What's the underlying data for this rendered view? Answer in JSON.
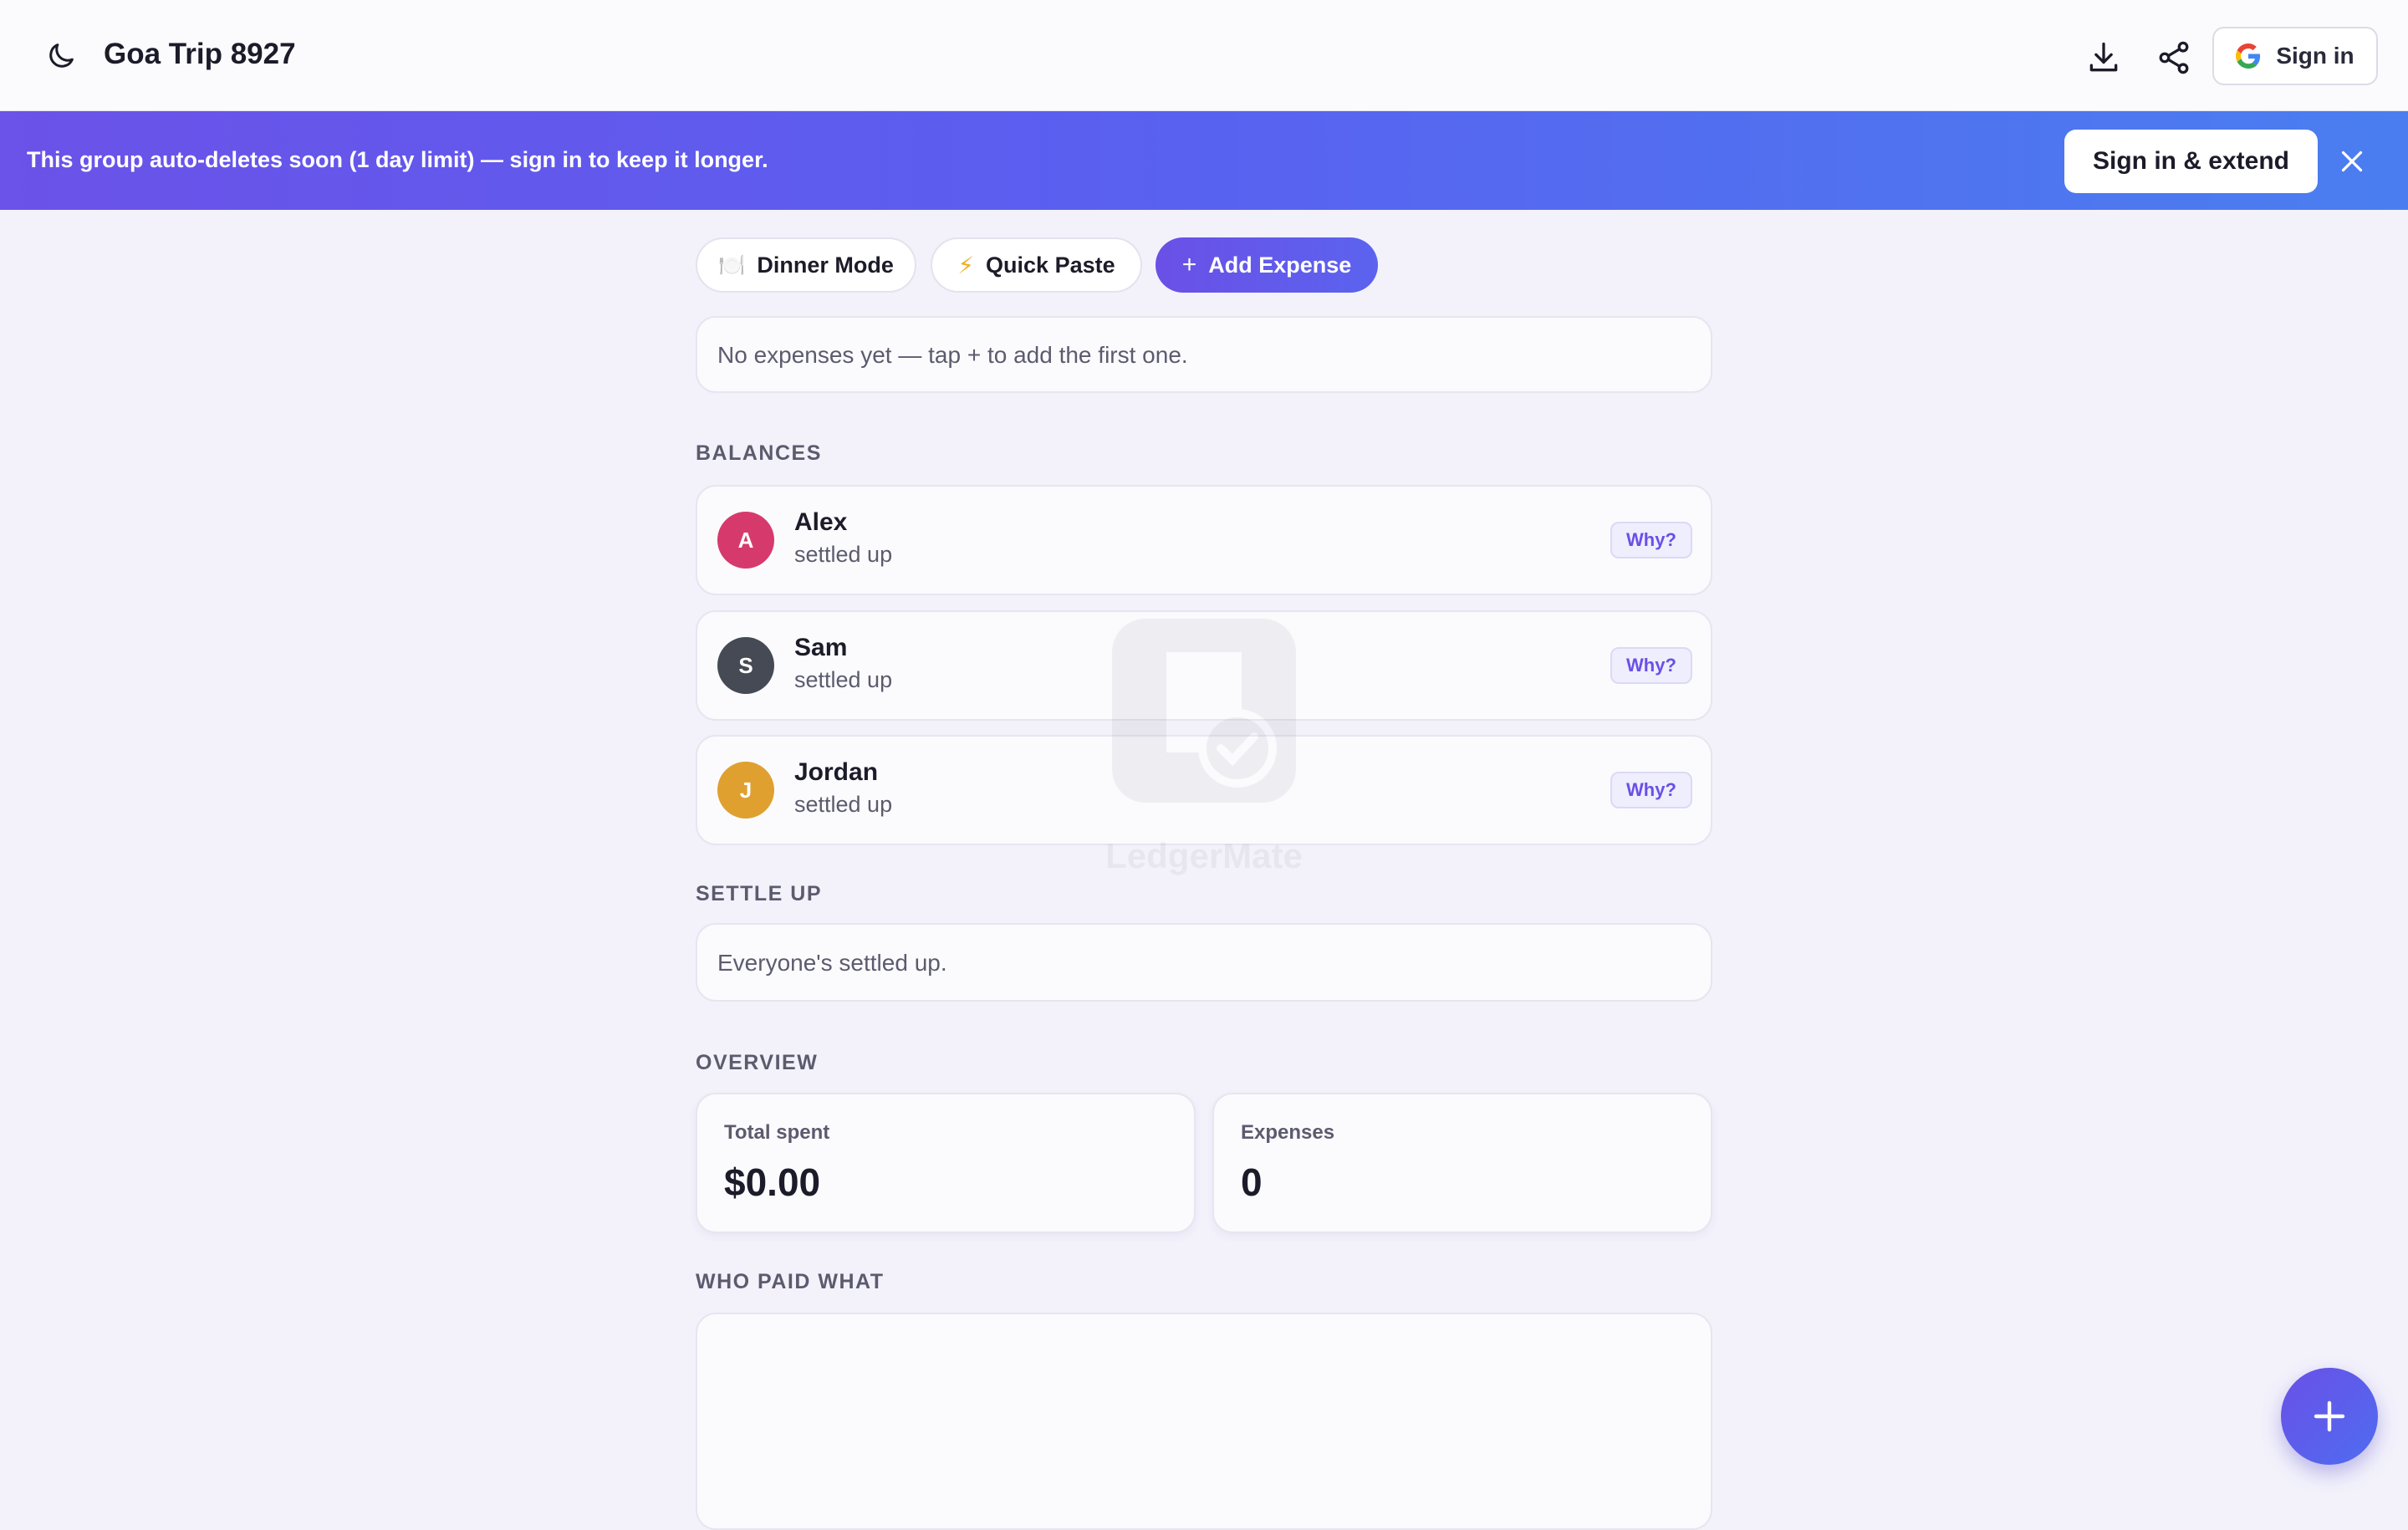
{
  "header": {
    "title": "Goa Trip 8927",
    "sign_in_label": "Sign in"
  },
  "banner": {
    "message": "This group auto-deletes soon (1 day limit) — sign in to keep it longer.",
    "cta_label": "Sign in & extend"
  },
  "actions": {
    "dinner_mode_label": "Dinner Mode",
    "quick_paste_label": "Quick Paste",
    "add_expense_label": "Add Expense"
  },
  "expenses": {
    "empty_message": "No expenses yet — tap + to add the first one."
  },
  "balances": {
    "section_label": "BALANCES",
    "people": [
      {
        "initial": "A",
        "name": "Alex",
        "status": "settled up",
        "color": "#d63a6c",
        "why_label": "Why?"
      },
      {
        "initial": "S",
        "name": "Sam",
        "status": "settled up",
        "color": "#454a54",
        "why_label": "Why?"
      },
      {
        "initial": "J",
        "name": "Jordan",
        "status": "settled up",
        "color": "#e0a030",
        "why_label": "Why?"
      }
    ]
  },
  "settle_up": {
    "section_label": "SETTLE UP",
    "message": "Everyone's settled up."
  },
  "overview": {
    "section_label": "OVERVIEW",
    "total_spent_label": "Total spent",
    "total_spent_value": "$0.00",
    "expenses_label": "Expenses",
    "expenses_value": "0"
  },
  "who_paid": {
    "section_label": "WHO PAID WHAT"
  },
  "watermark": {
    "text": "LedgerMate"
  },
  "colors": {
    "accent": "#6a50e6",
    "background": "#f3f2fb"
  }
}
